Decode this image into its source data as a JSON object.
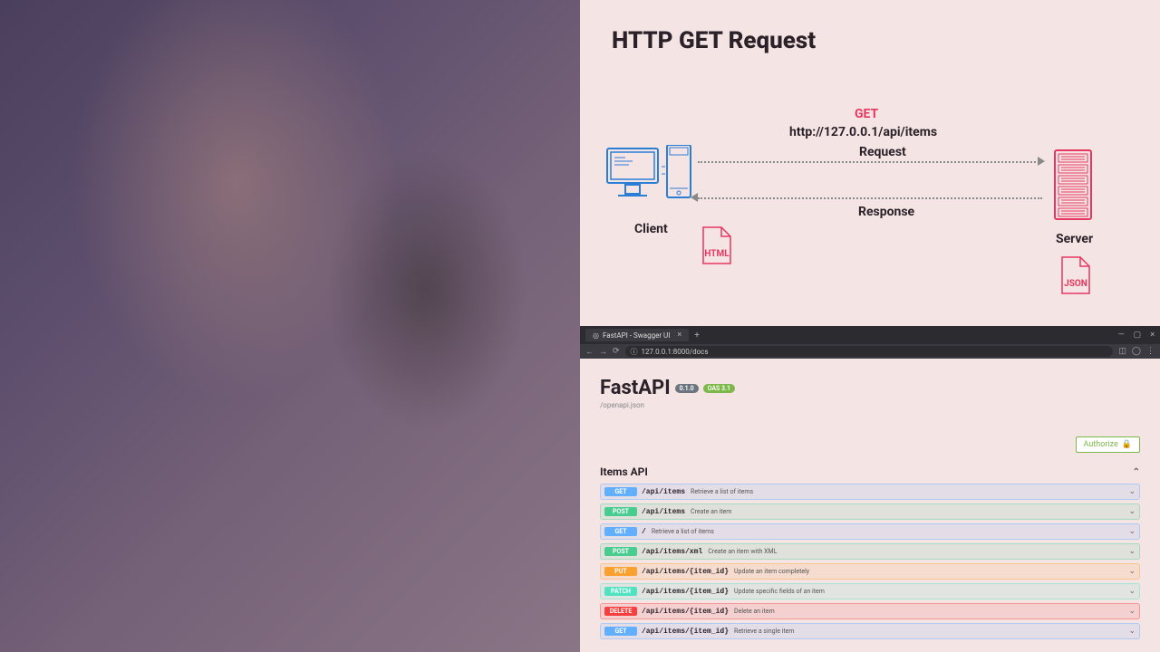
{
  "diagram": {
    "title": "HTTP GET Request",
    "method": "GET",
    "url": "http://127.0.0.1/api/items",
    "request_label": "Request",
    "response_label": "Response",
    "client_label": "Client",
    "server_label": "Server",
    "html_badge": "HTML",
    "json_badge": "JSON"
  },
  "browser": {
    "tab_title": "FastAPI - Swagger UI",
    "url": "127.0.0.1:8000/docs"
  },
  "swagger": {
    "title": "FastAPI",
    "version": "0.1.0",
    "oas": "OAS 3.1",
    "openapi_link": "/openapi.json",
    "authorize": "Authorize",
    "group": "Items API",
    "endpoints": [
      {
        "method": "GET",
        "path": "/api/items",
        "desc": "Retrieve a list of items"
      },
      {
        "method": "POST",
        "path": "/api/items",
        "desc": "Create an item"
      },
      {
        "method": "GET",
        "path": "/",
        "desc": "Retrieve a list of items"
      },
      {
        "method": "POST",
        "path": "/api/items/xml",
        "desc": "Create an item with XML"
      },
      {
        "method": "PUT",
        "path": "/api/items/{item_id}",
        "desc": "Update an item completely"
      },
      {
        "method": "PATCH",
        "path": "/api/items/{item_id}",
        "desc": "Update specific fields of an item"
      },
      {
        "method": "DELETE",
        "path": "/api/items/{item_id}",
        "desc": "Delete an item"
      },
      {
        "method": "GET",
        "path": "/api/items/{item_id}",
        "desc": "Retrieve a single item"
      }
    ]
  }
}
